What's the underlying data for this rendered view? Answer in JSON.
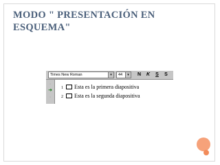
{
  "slide": {
    "title": "MODO \" PRESENTACIÓN EN ESQUEMA\""
  },
  "toolbar": {
    "font_name": "Times New Roman",
    "font_size": "44",
    "font_dropdown_arrow": "▾",
    "size_dropdown_arrow": "▾",
    "bold_label": "N",
    "italic_label": "K",
    "underline_label": "S",
    "shadow_label": "S"
  },
  "outline": {
    "items": [
      {
        "number": "1",
        "text": "Esta es la primera diapositiva"
      },
      {
        "number": "2",
        "text": "Esta es la segunda diapositiva"
      }
    ]
  },
  "icons": {
    "move_arrow": "➜"
  },
  "colors": {
    "title": "#4a5f7a",
    "accent_orange": "#f28b5a",
    "toolbar_gray": "#c6c6c6",
    "arrow_green": "#1a7a1a"
  }
}
